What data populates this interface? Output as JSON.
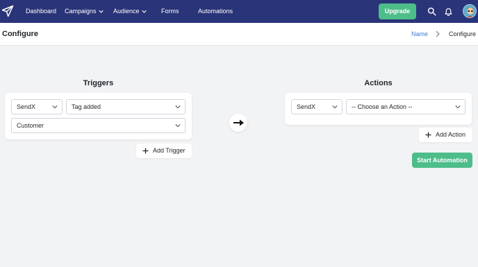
{
  "nav": {
    "items": [
      "Dashboard",
      "Campaigns",
      "Audience",
      "Forms",
      "Automations"
    ],
    "upgrade_label": "Upgrade"
  },
  "header": {
    "title": "Configure",
    "breadcrumb": {
      "link": "Name",
      "current": "Configure"
    }
  },
  "triggers": {
    "title": "Triggers",
    "source": "SendX",
    "event": "Tag added",
    "value": "Customer",
    "add_label": "Add Trigger"
  },
  "actions": {
    "title": "Actions",
    "source": "SendX",
    "action_placeholder": "-- Choose an Action --",
    "add_label": "Add Action",
    "start_label": "Start Automation"
  },
  "colors": {
    "nav_bg": "#2a3478",
    "accent_green": "#4dbd8a",
    "link_blue": "#3a7bd5",
    "page_bg": "#f2f3f5"
  },
  "icons": [
    "paper-plane-icon",
    "chevron-down-icon",
    "search-icon",
    "bell-icon",
    "avatar",
    "chevron-right-icon",
    "plus-icon",
    "arrow-right-icon"
  ]
}
